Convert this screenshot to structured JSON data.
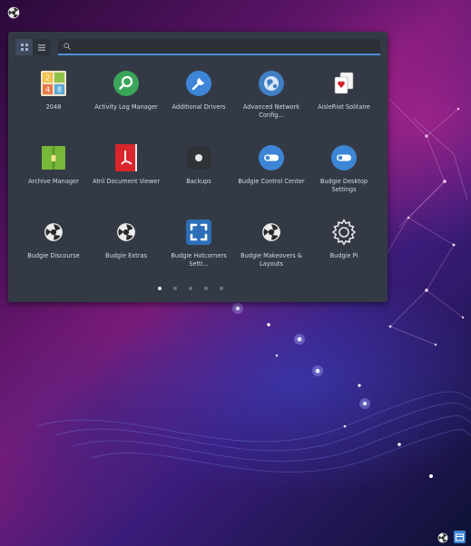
{
  "search": {
    "value": "",
    "placeholder": ""
  },
  "view_toggle": {
    "grid_icon": "grid-view-icon",
    "list_icon": "list-view-icon"
  },
  "apps": [
    {
      "label": "2048",
      "icon": "game-2048-icon"
    },
    {
      "label": "Activity Log Manager",
      "icon": "activity-log-icon"
    },
    {
      "label": "Additional Drivers",
      "icon": "drivers-icon"
    },
    {
      "label": "Advanced Network Config...",
      "icon": "network-icon"
    },
    {
      "label": "AisleRiot Solitaire",
      "icon": "cards-icon"
    },
    {
      "label": "Archive Manager",
      "icon": "archive-icon"
    },
    {
      "label": "Atril Document Viewer",
      "icon": "document-viewer-icon"
    },
    {
      "label": "Backups",
      "icon": "backups-icon"
    },
    {
      "label": "Budgie Control Center",
      "icon": "control-center-icon"
    },
    {
      "label": "Budgie Desktop Settings",
      "icon": "desktop-settings-icon"
    },
    {
      "label": "Budgie Discourse",
      "icon": "budgie-logo-icon"
    },
    {
      "label": "Budgie Extras",
      "icon": "budgie-logo-icon"
    },
    {
      "label": "Budgie Hotcorners Setti...",
      "icon": "hotcorners-icon"
    },
    {
      "label": "Budgie Makeovers & Layouts",
      "icon": "budgie-logo-icon"
    },
    {
      "label": "Budgie Pi",
      "icon": "gear-icon"
    }
  ],
  "pager": {
    "pages": 5,
    "current": 1
  },
  "colors": {
    "panel": "#343a45",
    "accent": "#4a90d9",
    "label": "#d6dae2"
  }
}
